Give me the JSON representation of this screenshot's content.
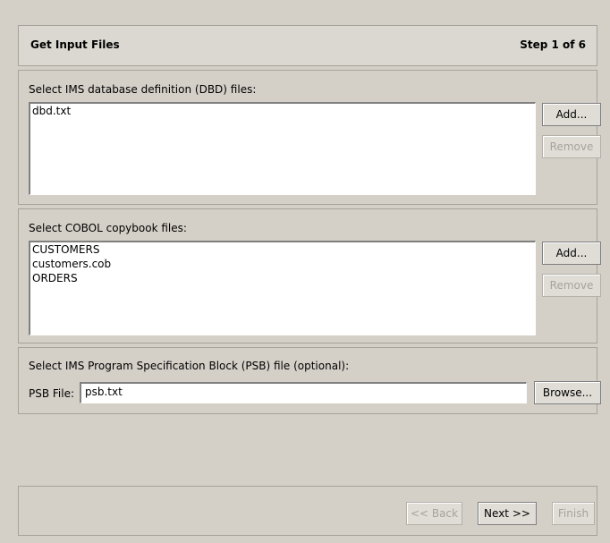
{
  "header": {
    "title": "Get Input Files",
    "step": "Step 1 of 6"
  },
  "dbd": {
    "label": "Select IMS database definition (DBD) files:",
    "items": [
      "dbd.txt"
    ],
    "add_label": "Add...",
    "remove_label": "Remove"
  },
  "cobol": {
    "label": "Select COBOL copybook files:",
    "items": [
      "CUSTOMERS",
      "customers.cob",
      "ORDERS"
    ],
    "add_label": "Add...",
    "remove_label": "Remove"
  },
  "psb": {
    "label": "Select IMS Program Specification Block (PSB) file (optional):",
    "field_label": "PSB File:",
    "value": "psb.txt",
    "browse_label": "Browse..."
  },
  "footer": {
    "back_label": "<< Back",
    "next_label": "Next >>",
    "finish_label": "Finish"
  }
}
